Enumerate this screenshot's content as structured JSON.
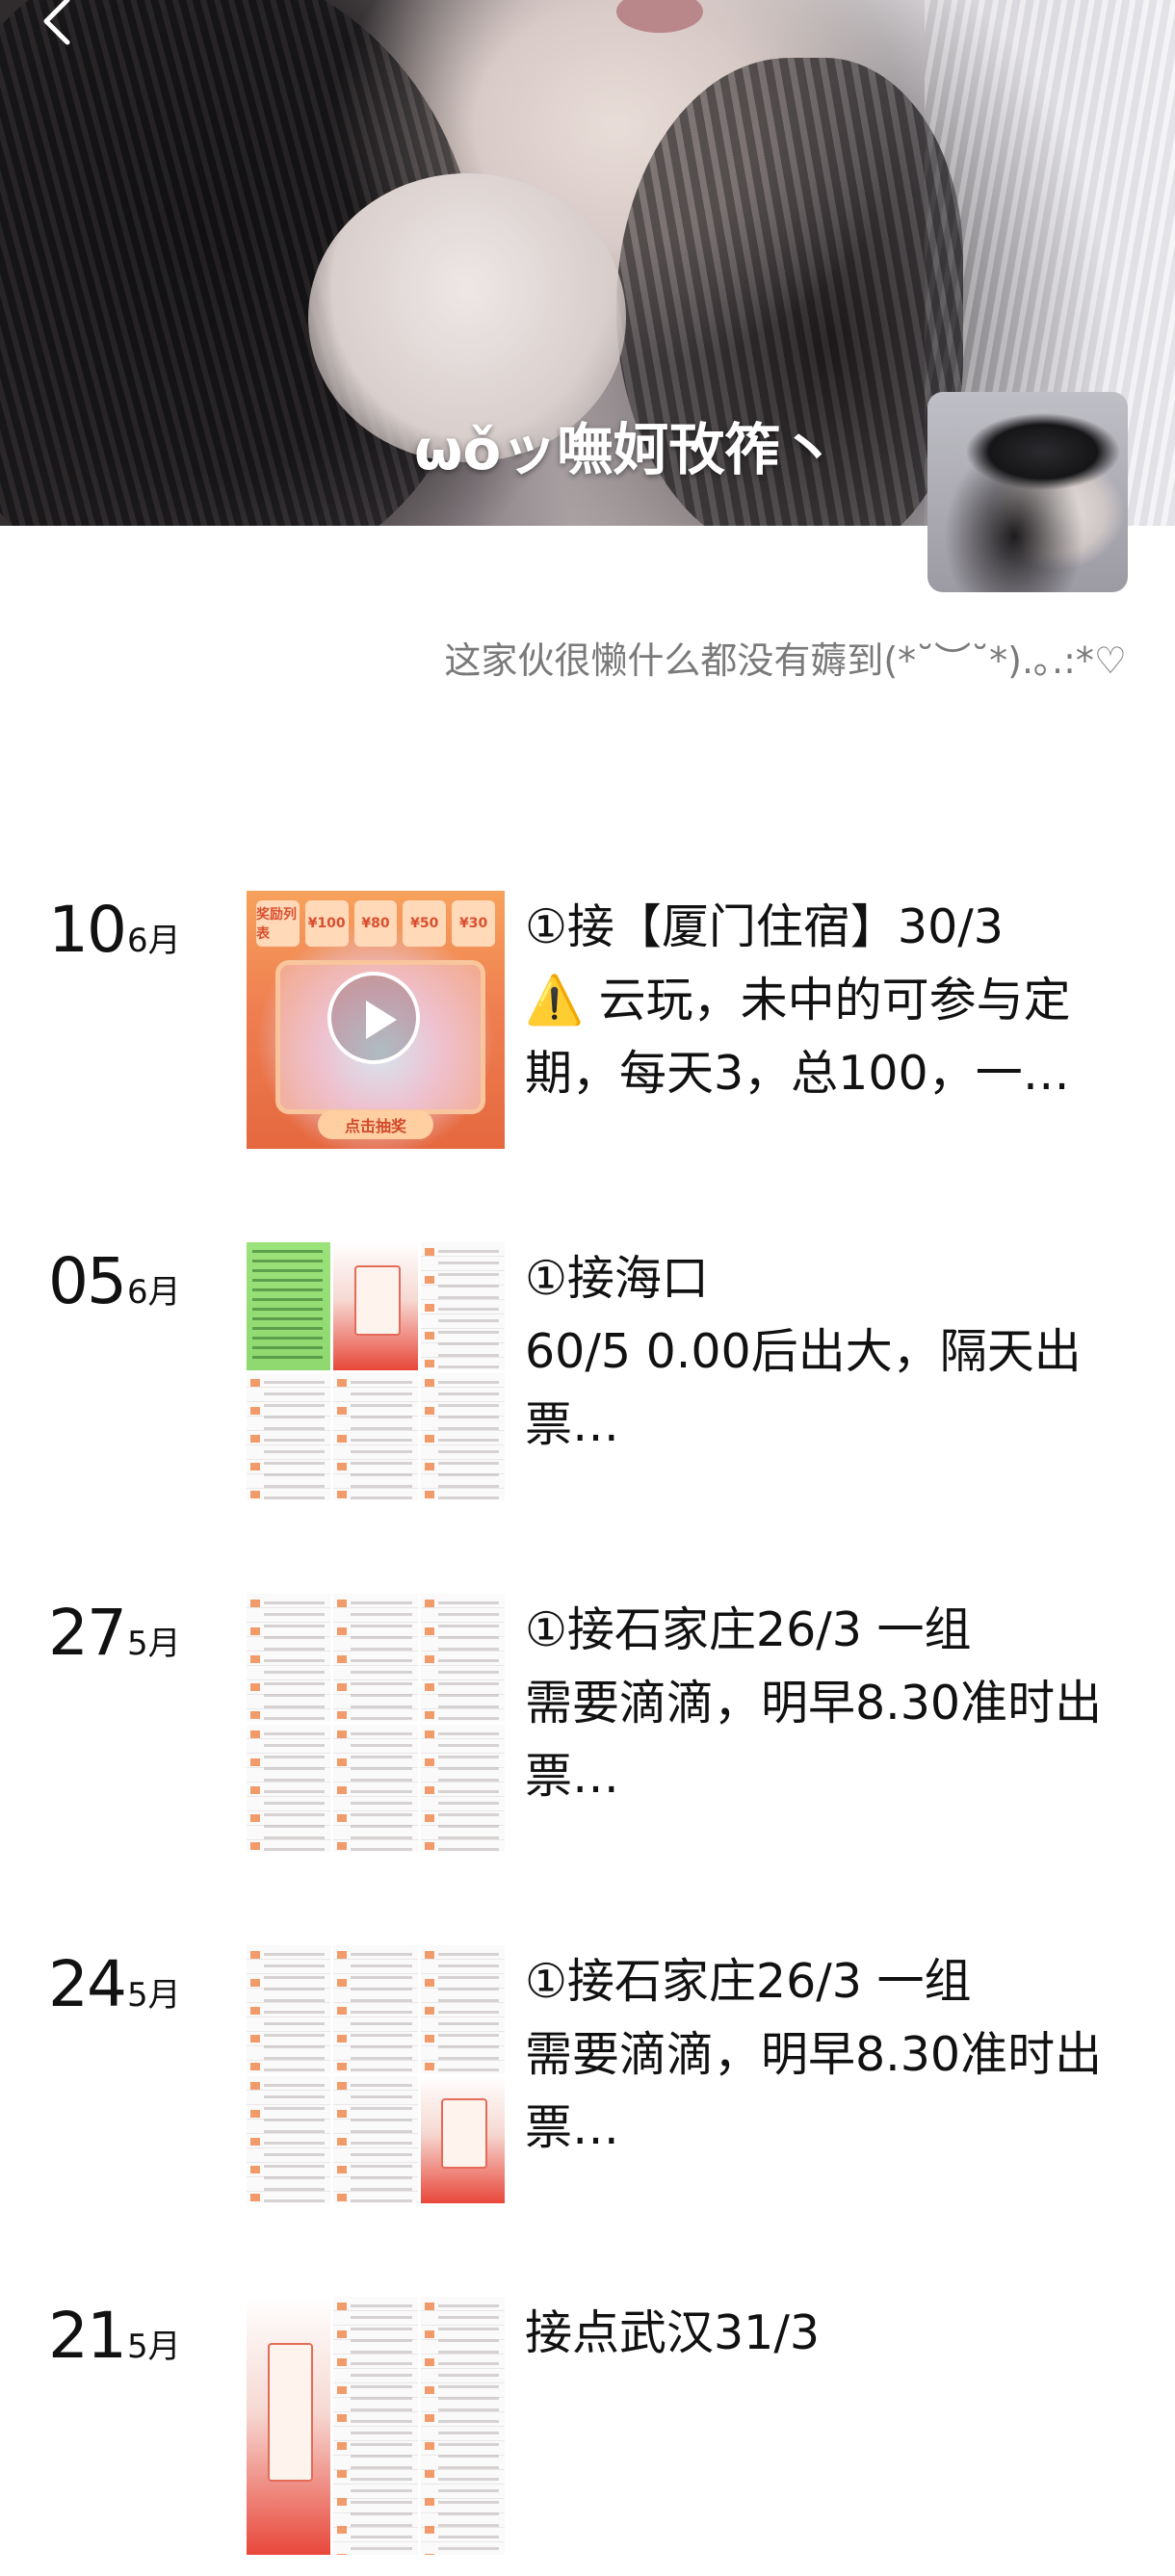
{
  "profile": {
    "nickname": "ωǒッ嘸妸攼筰丶",
    "bio": "这家伙很懒什么都没有薅到(*˘︶˘*).｡.:*♡"
  },
  "posts": [
    {
      "day": "10",
      "month": "6月",
      "media": "video",
      "thumb_labels": [
        "奖励列表",
        "¥100",
        "¥80",
        "¥50",
        "¥30",
        "点击抽奖"
      ],
      "lines": [
        "①接【厦门住宿】30/3",
        "⚠️ 云玩，未中的可参与定",
        "期，每天3，总100，一…"
      ]
    },
    {
      "day": "05",
      "month": "6月",
      "media": "images",
      "lines": [
        "①接海口",
        "60/5  0.00后出大，隔天出",
        "票…"
      ]
    },
    {
      "day": "27",
      "month": "5月",
      "media": "images",
      "lines": [
        "①接石家庄26/3  一组",
        "需要滴滴，明早8.30准时出",
        "票…"
      ]
    },
    {
      "day": "24",
      "month": "5月",
      "media": "images",
      "lines": [
        "①接石家庄26/3  一组",
        "需要滴滴，明早8.30准时出",
        "票…"
      ]
    },
    {
      "day": "21",
      "month": "5月",
      "media": "images",
      "lines": [
        "接点武汉31/3"
      ]
    }
  ]
}
